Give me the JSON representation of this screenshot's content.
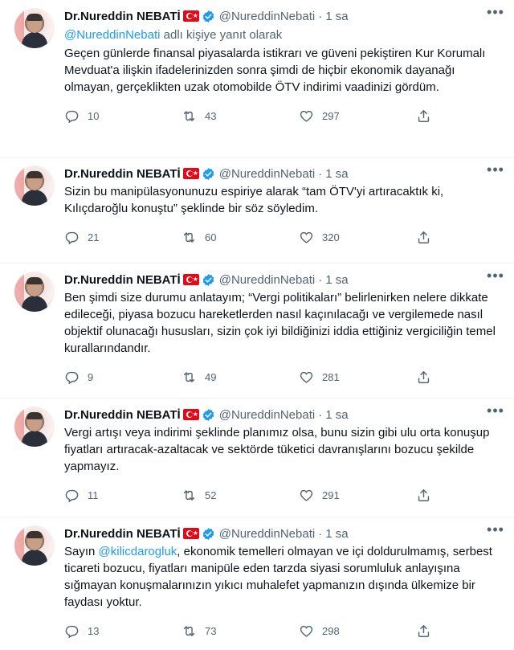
{
  "colors": {
    "accent": "#1d9bf0",
    "secondary_text": "#536471",
    "primary_text": "#0f1419",
    "flag_red": "#e30a17"
  },
  "tweets": [
    {
      "name": "Dr.Nureddin NEBATİ",
      "handle": "@NureddinNebati",
      "time": "1 sa",
      "reply_to": {
        "handle": "@NureddinNebati",
        "text": " adlı kişiye yanıt olarak"
      },
      "text": "Geçen günlerde finansal piyasalarda istikrarı ve güveni pekiştiren Kur Korumalı Mevduat'a ilişkin ifadelerinizden sonra şimdi de hiçbir ekonomik dayanağı olmayan, gerçeklikten uzak otomobilde ÖTV indirimi vaadinizi gördüm.",
      "replies": "10",
      "retweets": "43",
      "likes": "297"
    },
    {
      "name": "Dr.Nureddin NEBATİ",
      "handle": "@NureddinNebati",
      "time": "1 sa",
      "text": "Sizin bu manipülasyonunuzu espiriye alarak “tam ÖTV'yi artıracaktık ki, Kılıçdaroğlu konuştu” şeklinde bir söz söyledim.",
      "replies": "21",
      "retweets": "60",
      "likes": "320"
    },
    {
      "name": "Dr.Nureddin NEBATİ",
      "handle": "@NureddinNebati",
      "time": "1 sa",
      "text": "Ben şimdi size durumu anlatayım; “Vergi politikaları” belirlenirken nelere dikkate edileceği, piyasa bozucu hareketlerden nasıl kaçınılacağı ve vergilemede nasıl objektif olunacağı hususları, sizin çok iyi bildiğinizi iddia ettiğiniz vergiciliğin temel kurallarındandır.",
      "replies": "9",
      "retweets": "49",
      "likes": "281"
    },
    {
      "name": "Dr.Nureddin NEBATİ",
      "handle": "@NureddinNebati",
      "time": "1 sa",
      "text": "Vergi artışı veya indirimi şeklinde planımız olsa, bunu sizin gibi ulu orta konuşup fiyatları artıracak-azaltacak ve sektörde tüketici davranışlarını bozucu şekilde yapmayız.",
      "replies": "11",
      "retweets": "52",
      "likes": "291"
    },
    {
      "name": "Dr.Nureddin NEBATİ",
      "handle": "@NureddinNebati",
      "time": "1 sa",
      "mention_prefix": "Sayın ",
      "mention": "@kilicdarogluk",
      "text": ", ekonomik temelleri olmayan ve içi doldurulmamış, serbest ticareti bozucu, fiyatları manipüle eden tarzda siyasi sorumluluk anlayışına sığmayan konuşmalarınızın yıkıcı muhalefet yapmanızın dışında ülkemize bir faydası yoktur.",
      "replies": "13",
      "retweets": "73",
      "likes": "298"
    }
  ]
}
